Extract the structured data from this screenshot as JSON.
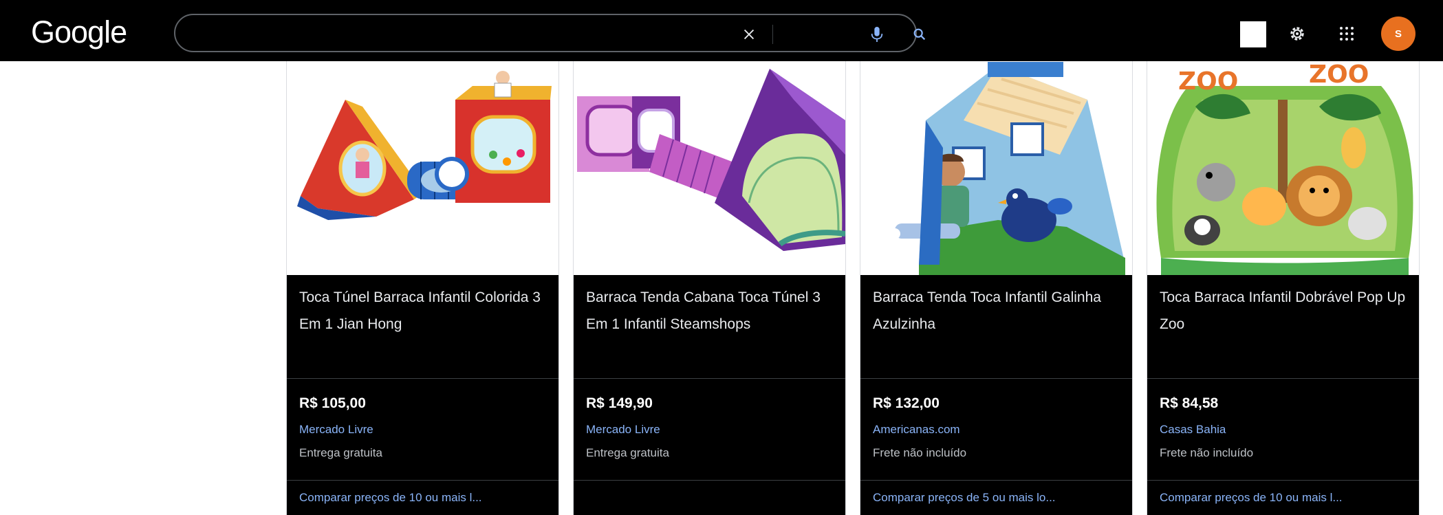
{
  "header": {
    "logo_text": "Google",
    "search": {
      "value": "",
      "placeholder": ""
    },
    "avatar_letter": "S",
    "icons": {
      "clear": "close-icon",
      "voice": "microphone-icon",
      "search": "search-icon",
      "settings": "gear-icon",
      "apps": "apps-grid-icon"
    },
    "avatar_color": "#e8701f"
  },
  "products": [
    {
      "title": "Toca Túnel Barraca Infantil Colorida 3 Em 1 Jian Hong",
      "price": "R$ 105,00",
      "store": "Mercado Livre",
      "shipping": "Entrega gratuita",
      "compare": "Comparar preços de 10 ou mais l..."
    },
    {
      "title": "Barraca Tenda Cabana Toca Túnel 3 Em 1 Infantil Steamshops",
      "price": "R$ 149,90",
      "store": "Mercado Livre",
      "shipping": "Entrega gratuita",
      "compare": ""
    },
    {
      "title": "Barraca Tenda Toca Infantil Galinha Azulzinha",
      "price": "R$ 132,00",
      "store": "Americanas.com",
      "shipping": "Frete não incluído",
      "compare": "Comparar preços de 5 ou mais lo..."
    },
    {
      "title": "Toca Barraca Infantil Dobrável Pop Up Zoo",
      "price": "R$ 84,58",
      "store": "Casas Bahia",
      "shipping": "Frete não incluído",
      "compare": "Comparar preços de 10 ou mais l..."
    }
  ],
  "colors": {
    "background": "#000000",
    "link": "#8ab4f8",
    "text": "#e8eaed",
    "secondary_text": "#bdc1c6"
  }
}
